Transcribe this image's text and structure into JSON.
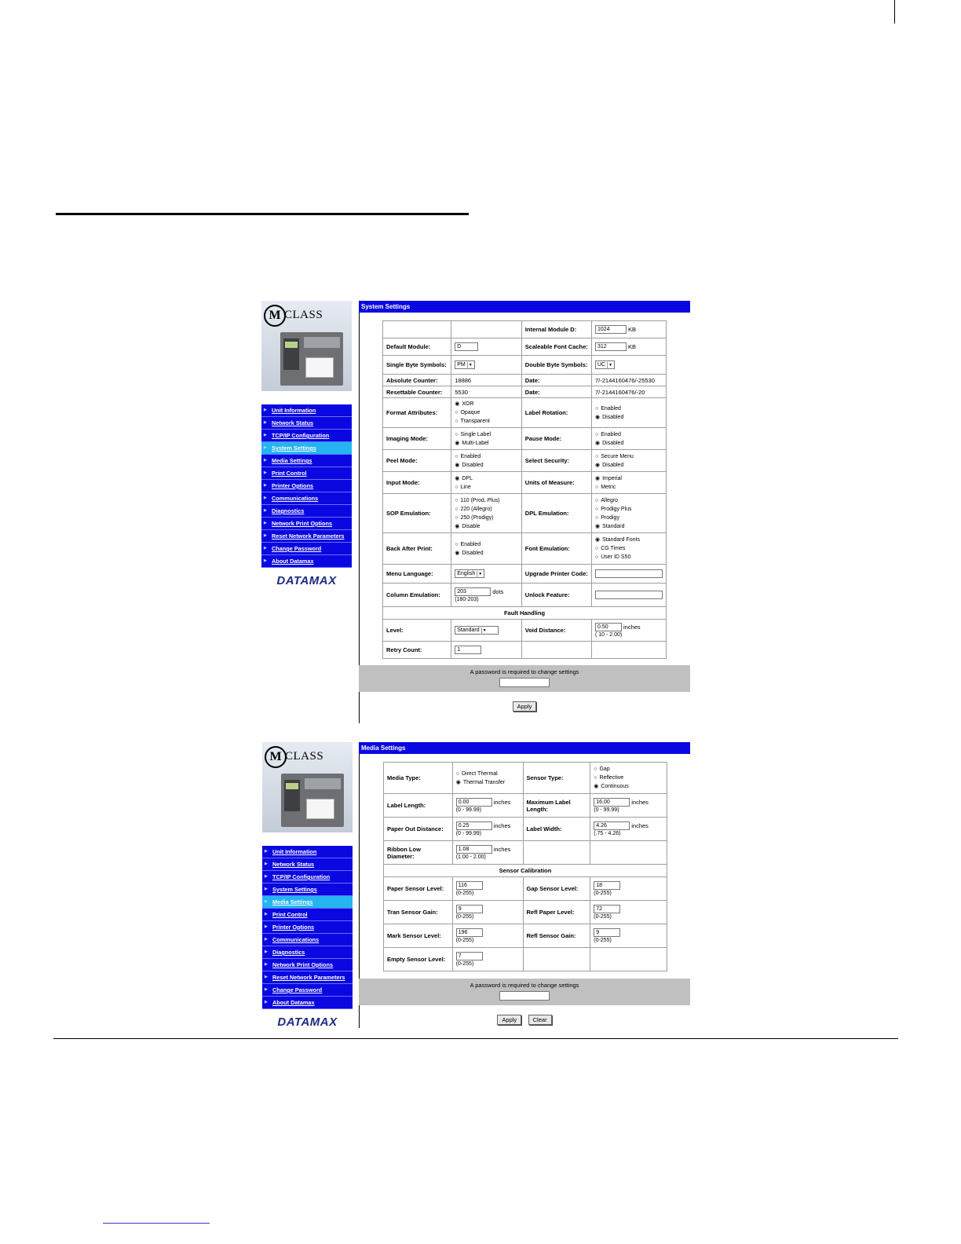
{
  "brand": {
    "m": "M",
    "class": "CLASS",
    "company": "DATAMAX"
  },
  "nav": [
    "Unit Information",
    "Network Status",
    "TCP/IP Configuration",
    "System Settings",
    "Media Settings",
    "Print Control",
    "Printer Options",
    "Communications",
    "Diagnostics",
    "Network Print Options",
    "Reset Network Parameters",
    "Change Password",
    "About Datamax"
  ],
  "system": {
    "title": "System Settings",
    "internal_module_label": "Internal Module D:",
    "internal_module_value": "1024",
    "internal_module_unit": "KB",
    "default_module_label": "Default Module:",
    "default_module_value": "D",
    "scaleable_cache_label": "Scaleable Font Cache:",
    "scaleable_cache_value": "312",
    "scaleable_cache_unit": "KB",
    "single_byte_label": "Single Byte Symbols:",
    "single_byte_value": "PM",
    "double_byte_label": "Double Byte Symbols:",
    "double_byte_value": "UC",
    "absolute_counter_label": "Absolute Counter:",
    "absolute_counter_value": "18886",
    "date_label": "Date:",
    "date1_value": "7/-2144160476/-25530",
    "resettable_counter_label": "Resettable Counter:",
    "resettable_counter_value": "5530",
    "date2_value": "7/-2144160476/-20",
    "format_attr_label": "Format Attributes:",
    "format_attr_opts": [
      "XOR",
      "Opaque",
      "Transparent"
    ],
    "label_rotation_label": "Label Rotation:",
    "label_rotation_opts": [
      "Enabled",
      "Disabled"
    ],
    "imaging_mode_label": "Imaging Mode:",
    "imaging_mode_opts": [
      "Single Label",
      "Multi-Label"
    ],
    "pause_mode_label": "Pause Mode:",
    "pause_mode_opts": [
      "Enabled",
      "Disabled"
    ],
    "peel_mode_label": "Peel Mode:",
    "peel_mode_opts": [
      "Enabled",
      "Disabled"
    ],
    "select_security_label": "Select Security:",
    "select_security_opts": [
      "Secure Menu",
      "Disabled"
    ],
    "input_mode_label": "Input Mode:",
    "input_mode_opts": [
      "DPL",
      "Line"
    ],
    "units_label": "Units of Measure:",
    "units_opts": [
      "Imperial",
      "Metric"
    ],
    "sop_label": "SOP Emulation:",
    "sop_opts": [
      "110 (Prod. Plus)",
      "220 (Allegro)",
      "250 (Prodigy)",
      "Disable"
    ],
    "dpl_label": "DPL Emulation:",
    "dpl_opts": [
      "Allegro",
      "Prodigy Plus",
      "Prodigy",
      "Standard"
    ],
    "back_after_label": "Back After Print:",
    "back_after_opts": [
      "Enabled",
      "Disabled"
    ],
    "font_emul_label": "Font Emulation:",
    "font_emul_opts": [
      "Standard Fonts",
      "CG Times",
      "User ID S50"
    ],
    "menu_lang_label": "Menu Language:",
    "menu_lang_value": "English",
    "upgrade_label": "Upgrade Printer Code:",
    "column_emul_label": "Column Emulation:",
    "column_emul_value": "203",
    "column_emul_unit": "dots",
    "column_emul_range": "(180-203)",
    "unlock_label": "Unlock Feature:",
    "fault_header": "Fault Handling",
    "level_label": "Level:",
    "level_value": "Standard",
    "void_label": "Void Distance:",
    "void_value": "0.50",
    "void_unit": "inches",
    "void_range": "( 10 - 2.00)",
    "retry_label": "Retry Count:",
    "retry_value": "1",
    "password_text": "A password is required to change settings",
    "apply": "Apply"
  },
  "media": {
    "title": "Media Settings",
    "media_type_label": "Media Type:",
    "media_type_opts": [
      "Direct Thermal",
      "Thermal Transfer"
    ],
    "sensor_type_label": "Sensor Type:",
    "sensor_type_opts": [
      "Gap",
      "Reflective",
      "Continuous"
    ],
    "label_length_label": "Label Length:",
    "label_length_value": "0.00",
    "label_length_unit": "inches",
    "label_length_range": "(0 - 99.99)",
    "max_label_label": "Maximum Label Length:",
    "max_label_value": "16.00",
    "max_label_unit": "inches",
    "max_label_range": "(0 - 99.99)",
    "paper_out_label": "Paper Out Distance:",
    "paper_out_value": "0.25",
    "paper_out_unit": "inches",
    "paper_out_range": "(0 - 99.99)",
    "label_width_label": "Label Width:",
    "label_width_value": "4.26",
    "label_width_unit": "inches",
    "label_width_range": "(.75 - 4.26)",
    "ribbon_label": "Ribbon Low Diameter:",
    "ribbon_value": "1.08",
    "ribbon_unit": "inches",
    "ribbon_range": "(1.00 - 2.00)",
    "sensor_header": "Sensor Calibration",
    "paper_sensor_label": "Paper Sensor Level:",
    "paper_sensor_value": "116",
    "gap_sensor_label": "Gap Sensor Level:",
    "gap_sensor_value": "18",
    "tran_gain_label": "Tran Sensor Gain:",
    "tran_gain_value": "9",
    "refl_paper_label": "Refl Paper Level:",
    "refl_paper_value": "72",
    "mark_sensor_label": "Mark Sensor Level:",
    "mark_sensor_value": "196",
    "refl_gain_label": "Refl Sensor Gain:",
    "refl_gain_value": "9",
    "empty_sensor_label": "Empty Sensor Level:",
    "empty_sensor_value": "7",
    "range_255": "(0-255)",
    "password_text": "A password is required to change settings",
    "apply": "Apply",
    "clear": "Clear"
  }
}
